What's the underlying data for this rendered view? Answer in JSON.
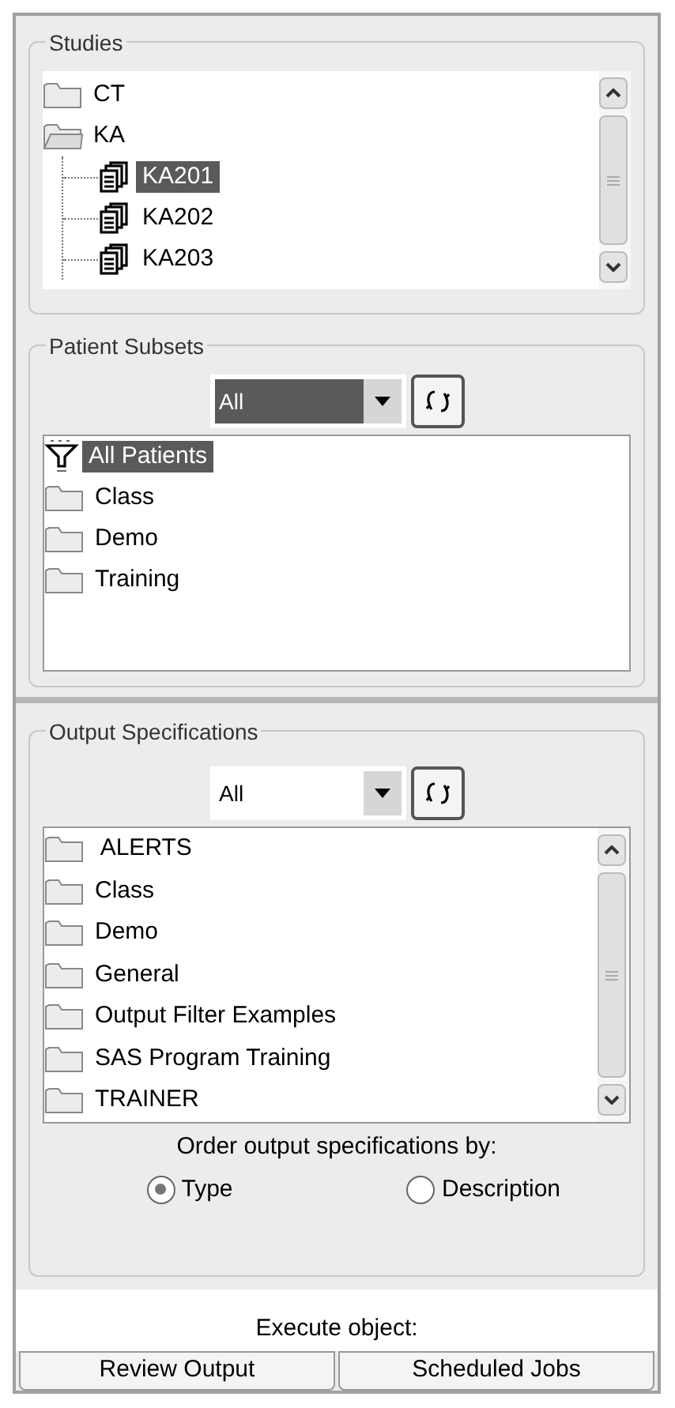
{
  "studies": {
    "title": "Studies",
    "tree": [
      {
        "label": "CT",
        "expanded": false,
        "kind": "folder",
        "selected": false
      },
      {
        "label": "KA",
        "expanded": true,
        "kind": "folder",
        "selected": false,
        "children": [
          {
            "label": "KA201",
            "kind": "study",
            "selected": true
          },
          {
            "label": "KA202",
            "kind": "study",
            "selected": false
          },
          {
            "label": "KA203",
            "kind": "study",
            "selected": false
          }
        ]
      }
    ]
  },
  "patient_subsets": {
    "title": "Patient Subsets",
    "combo": {
      "value": "All",
      "highlighted": true
    },
    "items": [
      {
        "label": "All Patients",
        "kind": "filter",
        "selected": true
      },
      {
        "label": "Class",
        "kind": "folder",
        "selected": false
      },
      {
        "label": "Demo",
        "kind": "folder",
        "selected": false
      },
      {
        "label": "Training",
        "kind": "folder",
        "selected": false
      }
    ]
  },
  "output_specifications": {
    "title": "Output Specifications",
    "combo": {
      "value": "All",
      "highlighted": false
    },
    "items": [
      {
        "label": " ALERTS",
        "kind": "folder",
        "selected": false
      },
      {
        "label": "Class",
        "kind": "folder",
        "selected": false
      },
      {
        "label": "Demo",
        "kind": "folder",
        "selected": false
      },
      {
        "label": "General",
        "kind": "folder",
        "selected": false
      },
      {
        "label": "Output Filter Examples",
        "kind": "folder",
        "selected": false
      },
      {
        "label": "SAS Program Training",
        "kind": "folder",
        "selected": false
      },
      {
        "label": "TRAINER",
        "kind": "folder",
        "selected": false
      }
    ],
    "order_label": "Order output specifications by:",
    "order_options": [
      {
        "label": "Type",
        "selected": true
      },
      {
        "label": "Description",
        "selected": false
      }
    ]
  },
  "execute_label": "Execute object:",
  "tabs": [
    {
      "label": "Review Output",
      "selected": false
    },
    {
      "label": "Scheduled Jobs",
      "selected": false
    }
  ]
}
